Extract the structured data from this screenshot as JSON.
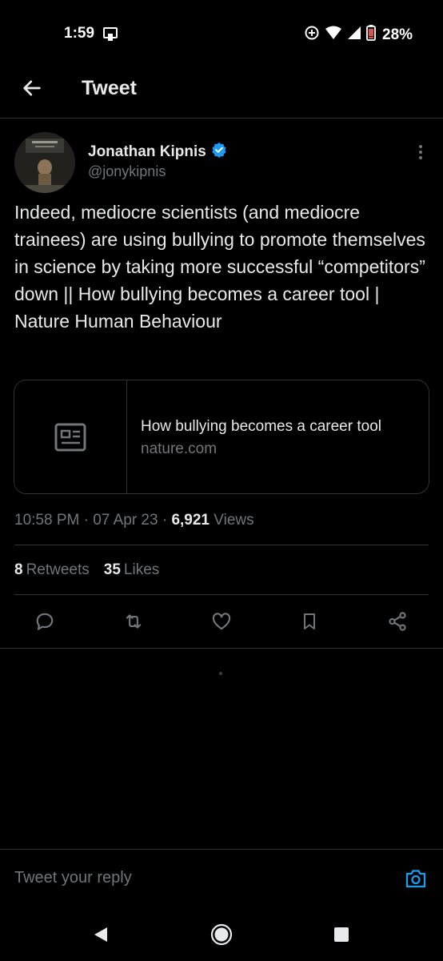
{
  "status_bar": {
    "time": "1:59",
    "battery_percent": "28%",
    "icons": [
      "cast-icon",
      "data-saver-icon",
      "wifi-icon",
      "signal-icon",
      "battery-low-icon"
    ]
  },
  "header": {
    "title": "Tweet",
    "back_icon": "arrow-left-icon"
  },
  "tweet": {
    "author": {
      "name": "Jonathan Kipnis",
      "handle": "@jonykipnis",
      "verified": true
    },
    "text": "Indeed, mediocre scientists (and mediocre trainees) are using bullying to promote themselves in science by taking more successful “competitors” down || How bullying becomes a career tool | Nature Human Behaviour",
    "link_card": {
      "title": "How bullying becomes a career tool",
      "domain": "nature.com",
      "icon": "article-icon"
    },
    "meta": {
      "time": "10:58 PM",
      "date": "07 Apr 23",
      "views_count": "6,921",
      "views_label": "Views"
    },
    "stats": {
      "retweets_count": "8",
      "retweets_label": "Retweets",
      "likes_count": "35",
      "likes_label": "Likes"
    },
    "actions": [
      "reply-icon",
      "retweet-icon",
      "like-icon",
      "bookmark-icon",
      "share-icon"
    ]
  },
  "reply": {
    "placeholder": "Tweet your reply"
  },
  "colors": {
    "background": "#000000",
    "text": "#e7e9ea",
    "secondary": "#71767b",
    "accent": "#1d9bf0",
    "border": "#2f3336",
    "battery_low": "#e0534a"
  }
}
